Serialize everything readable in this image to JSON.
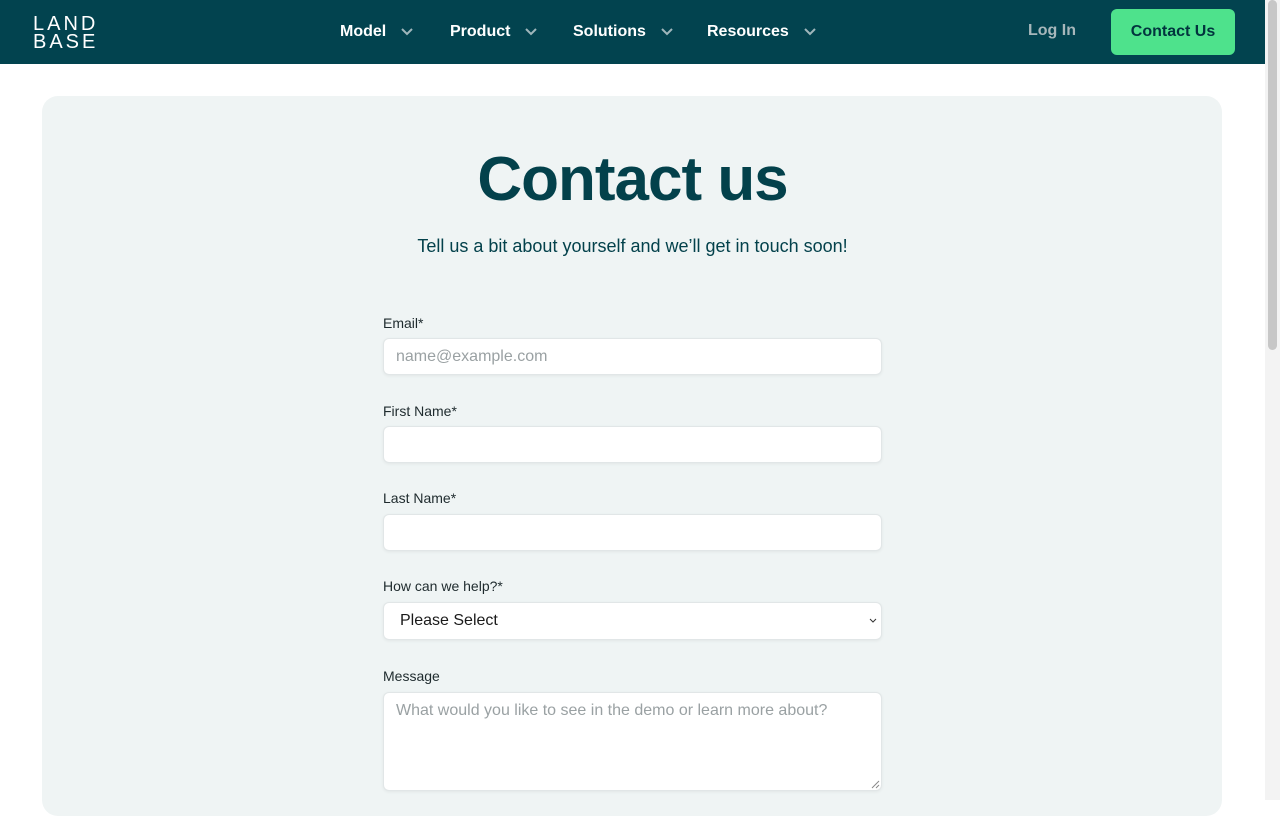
{
  "brand": {
    "logo_line1": "LAND",
    "logo_line2": "BASE",
    "colors": {
      "nav_bg": "#02434f",
      "accent": "#4ee28c",
      "heading": "#03414b",
      "card_bg": "#eff4f4"
    }
  },
  "nav": {
    "items": [
      {
        "label": "Model"
      },
      {
        "label": "Product"
      },
      {
        "label": "Solutions"
      },
      {
        "label": "Resources"
      }
    ],
    "login_label": "Log In",
    "cta_label": "Contact Us"
  },
  "main": {
    "title": "Contact us",
    "subtitle": "Tell us a bit about yourself and we’ll get in touch soon!"
  },
  "form": {
    "email": {
      "label": "Email*",
      "placeholder": "name@example.com",
      "value": ""
    },
    "first_name": {
      "label": "First Name*",
      "value": ""
    },
    "last_name": {
      "label": "Last Name*",
      "value": ""
    },
    "help": {
      "label": "How can we help?*",
      "selected": "Please Select"
    },
    "message": {
      "label": "Message",
      "placeholder": "What would you like to see in the demo or learn more about?"
    }
  },
  "icons": {
    "nav_dropdown": "chevron-down-icon",
    "select_dropdown": "chevron-down-icon",
    "textarea_resize": "resize-grip-icon"
  }
}
